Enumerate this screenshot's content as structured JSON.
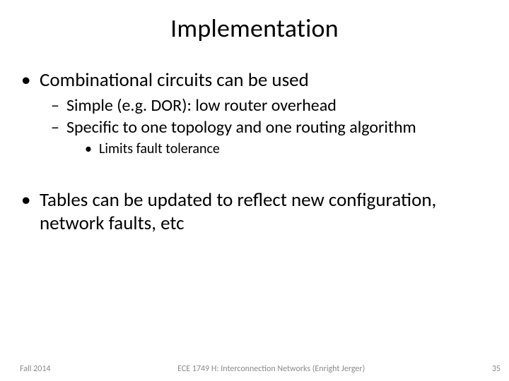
{
  "title": "Implementation",
  "bullets": [
    {
      "text": "Combinational circuits can be used",
      "children": [
        {
          "text": "Simple (e.g. DOR): low router overhead"
        },
        {
          "text": "Specific to one topology and one routing algorithm",
          "children": [
            {
              "text": "Limits fault tolerance"
            }
          ]
        }
      ]
    },
    {
      "text": "Tables can be updated to reflect new configuration, network faults, etc"
    }
  ],
  "footer": {
    "left": "Fall 2014",
    "center": "ECE 1749 H: Interconnection Networks (Enright Jerger)",
    "right": "35"
  }
}
